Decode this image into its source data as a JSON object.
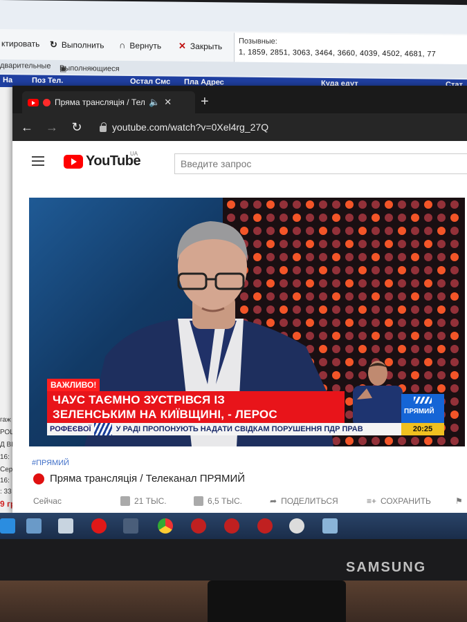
{
  "background_app": {
    "toolbar": {
      "edit_label": "ктировать",
      "execute_label": "Выполнить",
      "revert_label": "Вернуть",
      "close_label": "Закрыть"
    },
    "callsigns_label": "Позывные:",
    "callsigns_value": "1, 1859, 2851, 3063, 3464, 3660, 4039, 4502, 4681, 77",
    "tabs": [
      "дварительные",
      "Выполняющиеся"
    ],
    "columns": [
      "Ha",
      "Поз Тел.",
      "Остал Смс",
      "Пла Адрес",
      "Куда едут",
      "Стат"
    ],
    "left_fragments": [
      "гаж",
      "РОЦ",
      "Д ВЫ",
      "16:",
      "Сер",
      "16:",
      ": 33",
      "9 гр"
    ]
  },
  "browser": {
    "tab_title": "Пряма трансляція / Тел",
    "url": "youtube.com/watch?v=0Xel4rg_27Q"
  },
  "youtube": {
    "logo_text": "YouTube",
    "region": "UA",
    "search_placeholder": "Введите запрос",
    "player": {
      "tag": "ВАЖЛИВО!",
      "headline_line1": "ЧАУС ТАЄМНО ЗУСТРІВСЯ ІЗ",
      "headline_line2": "ЗЕЛЕНСЬКИМ НА КИЇВЩИНІ, - ЛЕРОС",
      "ticker_left": "РОФЕЄВОЇ",
      "ticker_text": "У РАДІ ПРОПОНУЮТЬ НАДАТИ СВІДКАМ ПОРУШЕННЯ ПДР ПРАВ",
      "channel": "ПРЯМИЙ",
      "clock": "20:25"
    },
    "hashtag": "#ПРЯМИЙ",
    "video_title": "Пряма трансляція / Телеканал ПРЯМИЙ",
    "published": "Сейчас",
    "likes": "21 ТЫС.",
    "dislikes": "6,5 ТЫС.",
    "share_label": "ПОДЕЛИТЬСЯ",
    "save_label": "СОХРАНИТЬ"
  },
  "monitor_brand": "SAMSUNG",
  "colors": {
    "youtube_red": "#ff0000",
    "breaking_red": "#e8141a",
    "channel_blue": "#1565d6"
  }
}
